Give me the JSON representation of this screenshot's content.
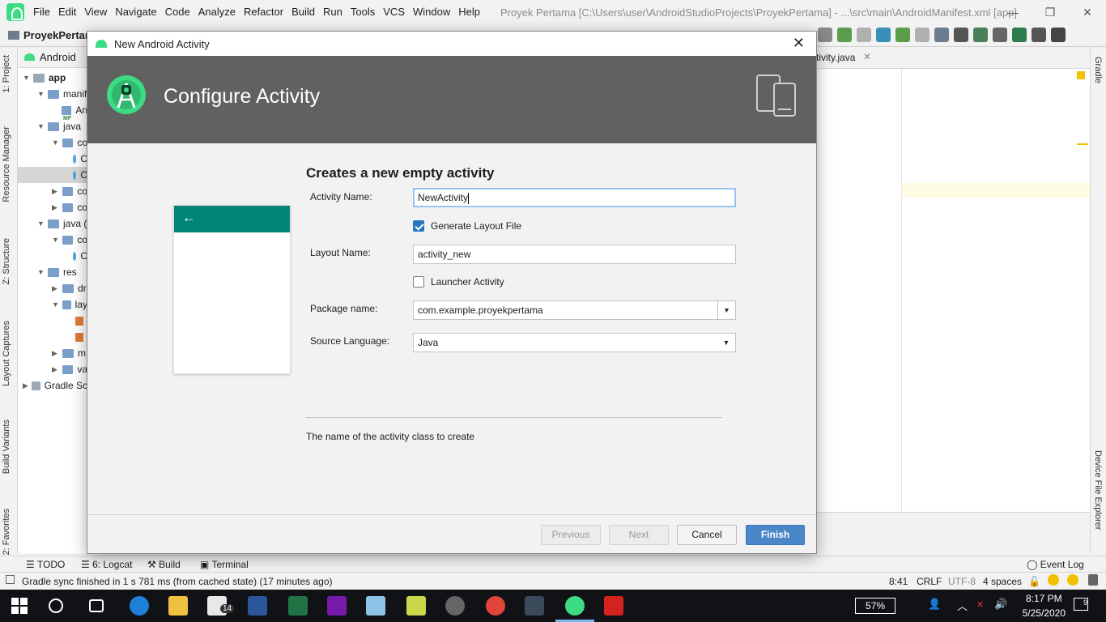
{
  "window": {
    "title": "Proyek Pertama [C:\\Users\\user\\AndroidStudioProjects\\ProyekPertama] - ...\\src\\main\\AndroidManifest.xml [app]",
    "menu": [
      "File",
      "Edit",
      "View",
      "Navigate",
      "Code",
      "Analyze",
      "Refactor",
      "Build",
      "Run",
      "Tools",
      "VCS",
      "Window",
      "Help"
    ],
    "controls": {
      "minimize": "—",
      "restore": "❐",
      "close": "✕"
    }
  },
  "toolbar": {
    "project_crumb": "ProyekPertam"
  },
  "left_strip": {
    "tabs": [
      "1: Project",
      "Resource Manager",
      "Z: Structure",
      "Layout Captures",
      "Build Variants",
      "2: Favorites"
    ]
  },
  "right_strip": {
    "tabs": [
      "Gradle",
      "Device File Explorer"
    ]
  },
  "project_panel": {
    "view_selector": "Android",
    "tree": [
      {
        "label": "app",
        "depth": 0,
        "expanded": true,
        "bold": true
      },
      {
        "label": "manif",
        "depth": 1,
        "expanded": true
      },
      {
        "label": "An",
        "depth": 2,
        "badge": "MF"
      },
      {
        "label": "java",
        "depth": 1,
        "expanded": true
      },
      {
        "label": "co",
        "depth": 2,
        "expanded": true
      },
      {
        "label": "C",
        "depth": 3
      },
      {
        "label": "C",
        "depth": 3,
        "selected": true
      },
      {
        "label": "co",
        "depth": 2,
        "expanded": false
      },
      {
        "label": "co",
        "depth": 2,
        "expanded": false
      },
      {
        "label": "java (",
        "depth": 1,
        "expanded": true
      },
      {
        "label": "co",
        "depth": 2,
        "expanded": true
      },
      {
        "label": "C",
        "depth": 3
      },
      {
        "label": "res",
        "depth": 1,
        "expanded": true
      },
      {
        "label": "dr",
        "depth": 2,
        "expanded": false
      },
      {
        "label": "lay",
        "depth": 2,
        "expanded": true
      },
      {
        "label": "",
        "depth": 3
      },
      {
        "label": "",
        "depth": 3
      },
      {
        "label": "m",
        "depth": 2,
        "expanded": false
      },
      {
        "label": "va",
        "depth": 2,
        "expanded": false
      },
      {
        "label": "Gradle Sc",
        "depth": 0,
        "expanded": false
      }
    ]
  },
  "editor": {
    "tab_label": "tivity.java",
    "tab_close": "✕"
  },
  "dialog": {
    "title": "New Android Activity",
    "close": "✕",
    "header_title": "Configure Activity",
    "form_title": "Creates a new empty activity",
    "preview_back": "←",
    "fields": {
      "activity_name": {
        "label": "Activity Name:",
        "value": "NewActivity"
      },
      "generate_layout": {
        "label": "Generate Layout File",
        "checked": true
      },
      "layout_name": {
        "label": "Layout Name:",
        "value": "activity_new"
      },
      "launcher_activity": {
        "label": "Launcher Activity",
        "checked": false
      },
      "package_name": {
        "label": "Package name:",
        "value": "com.example.proyekpertama"
      },
      "source_language": {
        "label": "Source Language:",
        "value": "Java"
      }
    },
    "help_text": "The name of the activity class to create",
    "buttons": {
      "previous": "Previous",
      "next": "Next",
      "cancel": "Cancel",
      "finish": "Finish"
    }
  },
  "bottom_tabs": [
    "TODO",
    "6: Logcat",
    "Build",
    "Terminal"
  ],
  "event_log": "Event Log",
  "status": {
    "message": "Gradle sync finished in 1 s 781 ms (from cached state) (17 minutes ago)",
    "position": "8:41",
    "line_sep": "CRLF",
    "encoding": "UTF-8",
    "indent": "4 spaces"
  },
  "taskbar": {
    "battery": "57%",
    "time": "8:17 PM",
    "date": "5/25/2020",
    "notifications": "9",
    "mail_badge": "14"
  },
  "colors": {
    "dialog_header": "#616161",
    "preview_bar": "#008577",
    "finish_button": "#4a86c8",
    "android_green": "#3ddc84"
  }
}
